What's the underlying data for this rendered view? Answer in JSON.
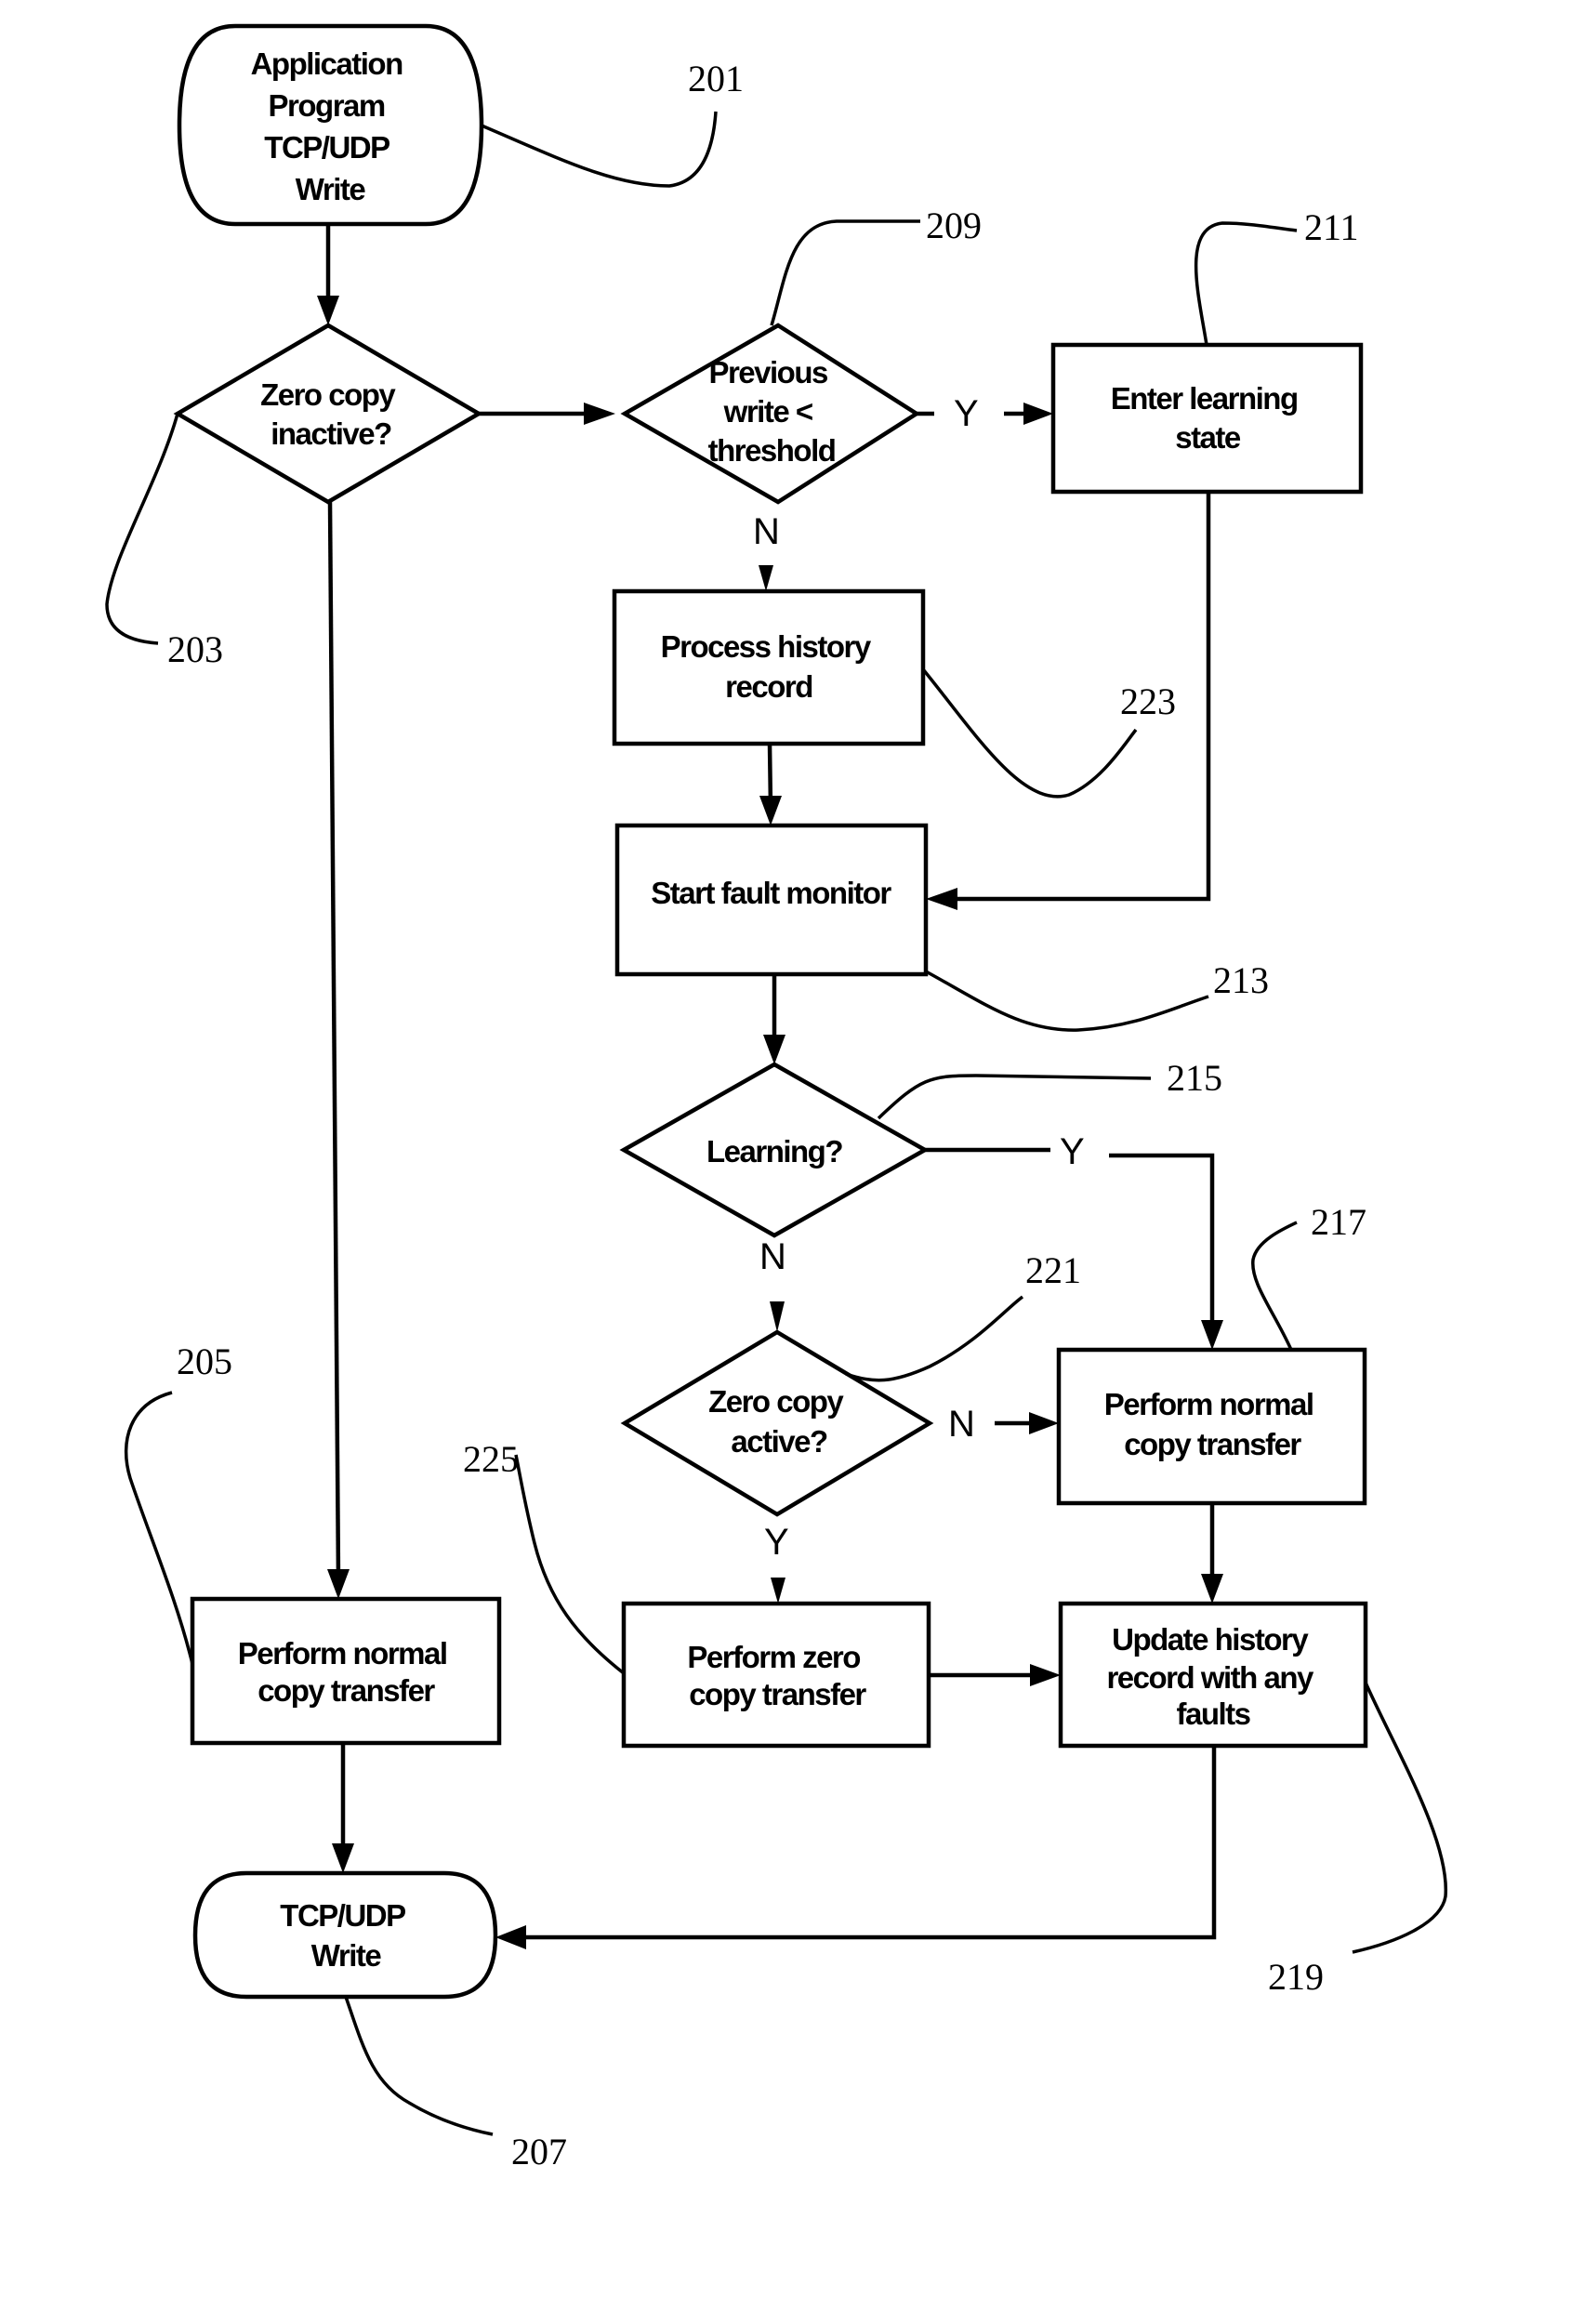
{
  "diagram": {
    "type": "flowchart",
    "nodes": [
      {
        "id": "201",
        "kind": "terminator",
        "lines": [
          "Application",
          "Program",
          "TCP/UDP",
          "Write"
        ]
      },
      {
        "id": "203",
        "kind": "decision",
        "lines": [
          "Zero copy",
          "inactive?"
        ]
      },
      {
        "id": "209",
        "kind": "decision",
        "lines": [
          "Previous",
          "write <",
          "threshold"
        ]
      },
      {
        "id": "211",
        "kind": "process",
        "lines": [
          "Enter learning",
          "state"
        ]
      },
      {
        "id": "223",
        "kind": "process",
        "lines": [
          "Process history",
          "record"
        ]
      },
      {
        "id": "213",
        "kind": "process",
        "lines": [
          "Start fault monitor"
        ]
      },
      {
        "id": "215",
        "kind": "decision",
        "lines": [
          "Learning?"
        ]
      },
      {
        "id": "221",
        "kind": "decision",
        "lines": [
          "Zero copy",
          "active?"
        ]
      },
      {
        "id": "217",
        "kind": "process",
        "lines": [
          "Perform normal",
          "copy transfer"
        ]
      },
      {
        "id": "225",
        "kind": "process",
        "lines": [
          "Perform zero",
          "copy transfer"
        ]
      },
      {
        "id": "219",
        "kind": "process",
        "lines": [
          "Update history",
          "record with any",
          "faults"
        ]
      },
      {
        "id": "205",
        "kind": "process",
        "lines": [
          "Perform normal",
          "copy transfer"
        ]
      },
      {
        "id": "207",
        "kind": "terminator",
        "lines": [
          "TCP/UDP",
          "Write"
        ]
      }
    ],
    "edges": [
      {
        "from": "201",
        "to": "203",
        "label": ""
      },
      {
        "from": "203",
        "to": "209",
        "label": ""
      },
      {
        "from": "203",
        "to": "205",
        "label": ""
      },
      {
        "from": "209",
        "to": "211",
        "label": "Y"
      },
      {
        "from": "209",
        "to": "223",
        "label": "N"
      },
      {
        "from": "211",
        "to": "213",
        "label": ""
      },
      {
        "from": "223",
        "to": "213",
        "label": ""
      },
      {
        "from": "213",
        "to": "215",
        "label": ""
      },
      {
        "from": "215",
        "to": "217",
        "label": "Y"
      },
      {
        "from": "215",
        "to": "221",
        "label": "N"
      },
      {
        "from": "221",
        "to": "217",
        "label": "N"
      },
      {
        "from": "221",
        "to": "225",
        "label": "Y"
      },
      {
        "from": "217",
        "to": "219",
        "label": ""
      },
      {
        "from": "225",
        "to": "219",
        "label": ""
      },
      {
        "from": "219",
        "to": "207",
        "label": ""
      },
      {
        "from": "205",
        "to": "207",
        "label": ""
      }
    ],
    "reference_numerals": [
      "201",
      "203",
      "205",
      "207",
      "209",
      "211",
      "213",
      "215",
      "217",
      "219",
      "221",
      "223",
      "225"
    ],
    "edge_labels": {
      "yes": "Y",
      "no": "N"
    }
  }
}
